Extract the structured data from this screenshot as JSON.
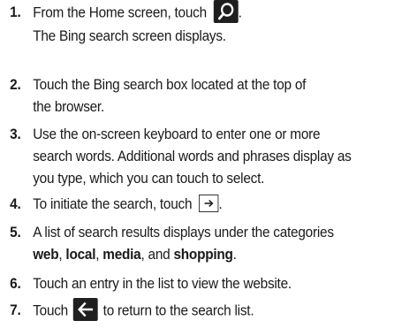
{
  "steps": [
    {
      "number": "1.",
      "line1_pre": "From the Home screen, touch",
      "line1_post": ".",
      "line2": "The Bing search screen displays."
    },
    {
      "number": "2.",
      "line1": "Touch the Bing search box located at the top of",
      "line2": "the browser."
    },
    {
      "number": "3.",
      "line1": "Use the on-screen keyboard to enter one or more",
      "line2": "search words. Additional words and phrases display as",
      "line3": "you type, which you can touch to select."
    },
    {
      "number": "4.",
      "line1_pre": "To initiate the search, touch",
      "line1_post": "."
    },
    {
      "number": "5.",
      "line1": "A list of search results displays under the categories",
      "cat1": "web",
      "sep1": ", ",
      "cat2": "local",
      "sep2": ", ",
      "cat3": "media",
      "sep3": ", and ",
      "cat4": "shopping",
      "end": "."
    },
    {
      "number": "6.",
      "line1": "Touch an entry in the list to view the website."
    },
    {
      "number": "7.",
      "line1_pre": "Touch",
      "line1_post": "to return to the search list."
    }
  ],
  "icons": {
    "step1": "search-icon",
    "step4": "arrow-right-icon",
    "step7": "back-arrow-icon"
  }
}
